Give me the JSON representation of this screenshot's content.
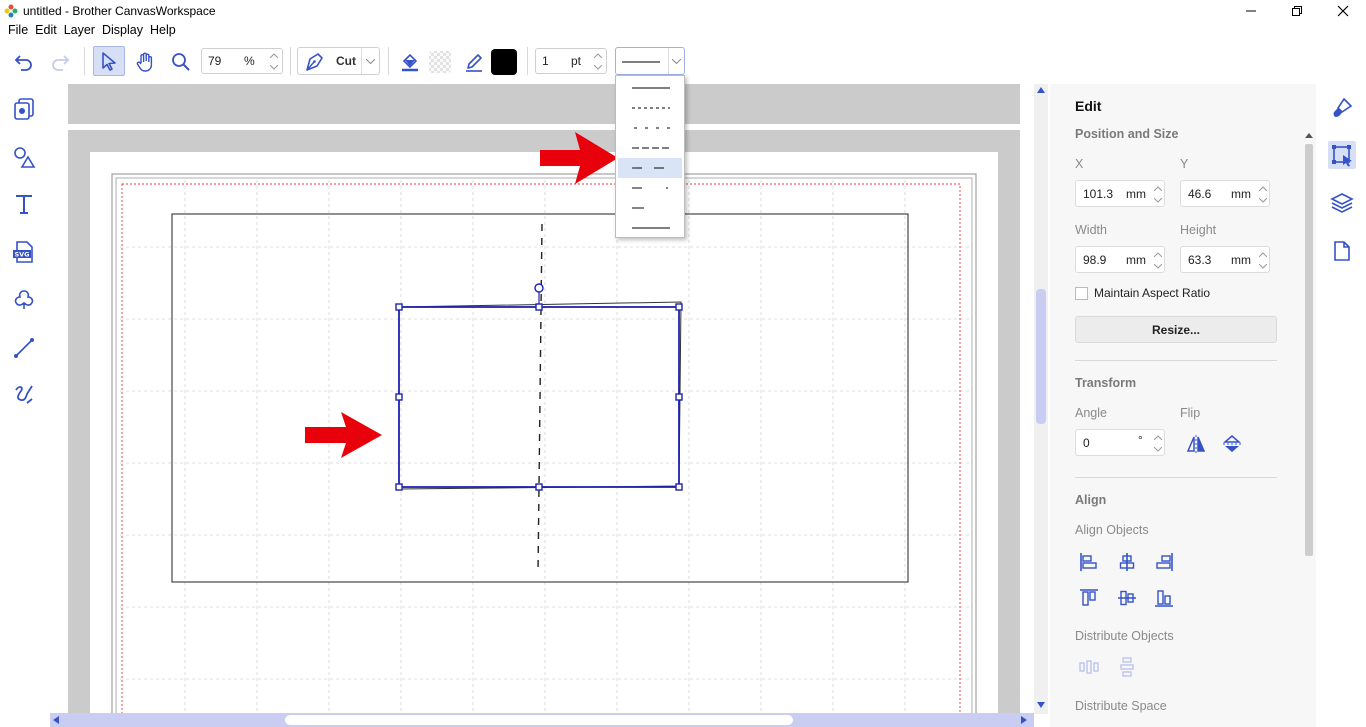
{
  "window": {
    "title": "untitled - Brother CanvasWorkspace"
  },
  "menu": {
    "items": [
      "File",
      "Edit",
      "Layer",
      "Display",
      "Help"
    ]
  },
  "toolbar": {
    "zoom_value": "79",
    "zoom_unit": "%",
    "mode_label": "Cut",
    "line_width_value": "1",
    "line_width_unit": "pt",
    "line_color": "#000000"
  },
  "line_style_dropdown": {
    "options": [
      "solid",
      "dash-fine",
      "dash-dot-spaced",
      "long-dash",
      "long-dash-wide",
      "dash-dot",
      "short-dash",
      "solid-long"
    ],
    "selected_index": 4
  },
  "edit_panel": {
    "title": "Edit",
    "position_size": {
      "heading": "Position and Size",
      "x_label": "X",
      "x_value": "101.3",
      "x_unit": "mm",
      "y_label": "Y",
      "y_value": "46.6",
      "y_unit": "mm",
      "width_label": "Width",
      "width_value": "98.9",
      "width_unit": "mm",
      "height_label": "Height",
      "height_value": "63.3",
      "height_unit": "mm",
      "aspect_label": "Maintain Aspect Ratio",
      "aspect_checked": false,
      "resize_label": "Resize..."
    },
    "transform": {
      "heading": "Transform",
      "angle_label": "Angle",
      "angle_value": "0",
      "angle_unit": "°",
      "flip_label": "Flip"
    },
    "align": {
      "heading": "Align",
      "align_objects_label": "Align Objects",
      "distribute_objects_label": "Distribute Objects",
      "distribute_space_label": "Distribute Space"
    }
  },
  "colors": {
    "accent": "#3552c8",
    "selection": "#1f23b0",
    "arrow_annotation": "#e8000b",
    "cut_area": "#e13a3a"
  }
}
